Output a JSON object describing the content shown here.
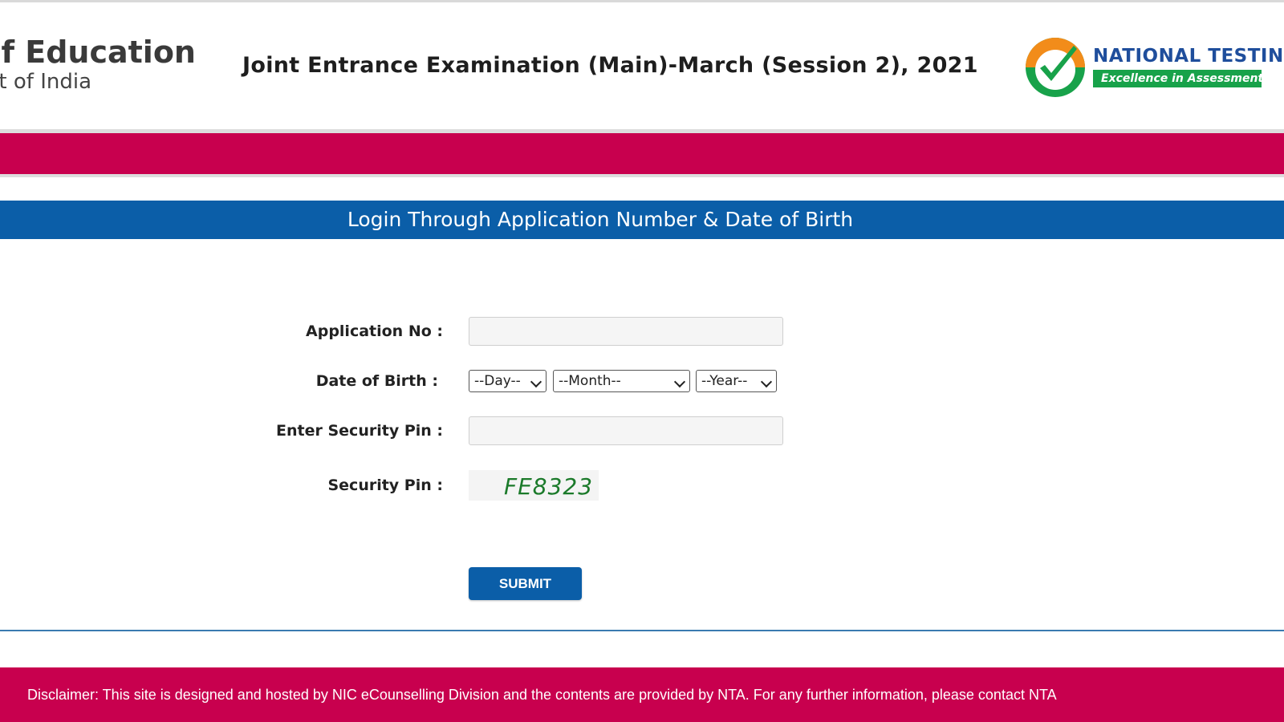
{
  "header": {
    "ministry_line1": "y of Education",
    "ministry_line2": "t of India",
    "exam_title": "Joint Entrance Examination (Main)-March (Session 2), 2021",
    "nta_name": "NATIONAL TESTING",
    "nta_tagline": "Excellence in Assessment"
  },
  "login": {
    "title": "Login Through Application Number & Date of Birth",
    "application_no_label": "Application No :",
    "application_no_value": "",
    "dob_label": "Date of Birth :",
    "day_placeholder": "--Day--",
    "month_placeholder": "--Month--",
    "year_placeholder": "--Year--",
    "enter_pin_label": "Enter Security Pin :",
    "enter_pin_value": "",
    "security_pin_label": "Security Pin :",
    "captcha_text": "FE8323",
    "submit_label": "SUBMIT"
  },
  "footer": {
    "disclaimer": "Disclaimer: This site is designed and hosted by NIC eCounselling Division and the contents are provided by NTA. For any further information, please contact NTA"
  },
  "colors": {
    "crimson": "#c8004e",
    "blue": "#0b5ea8",
    "nta_green": "#18a24a",
    "nta_orange": "#f28c1a",
    "nta_blue": "#1f4e9c"
  },
  "icons": {
    "nta_emblem": "check-circle-icon",
    "dropdown": "chevron-down-icon"
  }
}
